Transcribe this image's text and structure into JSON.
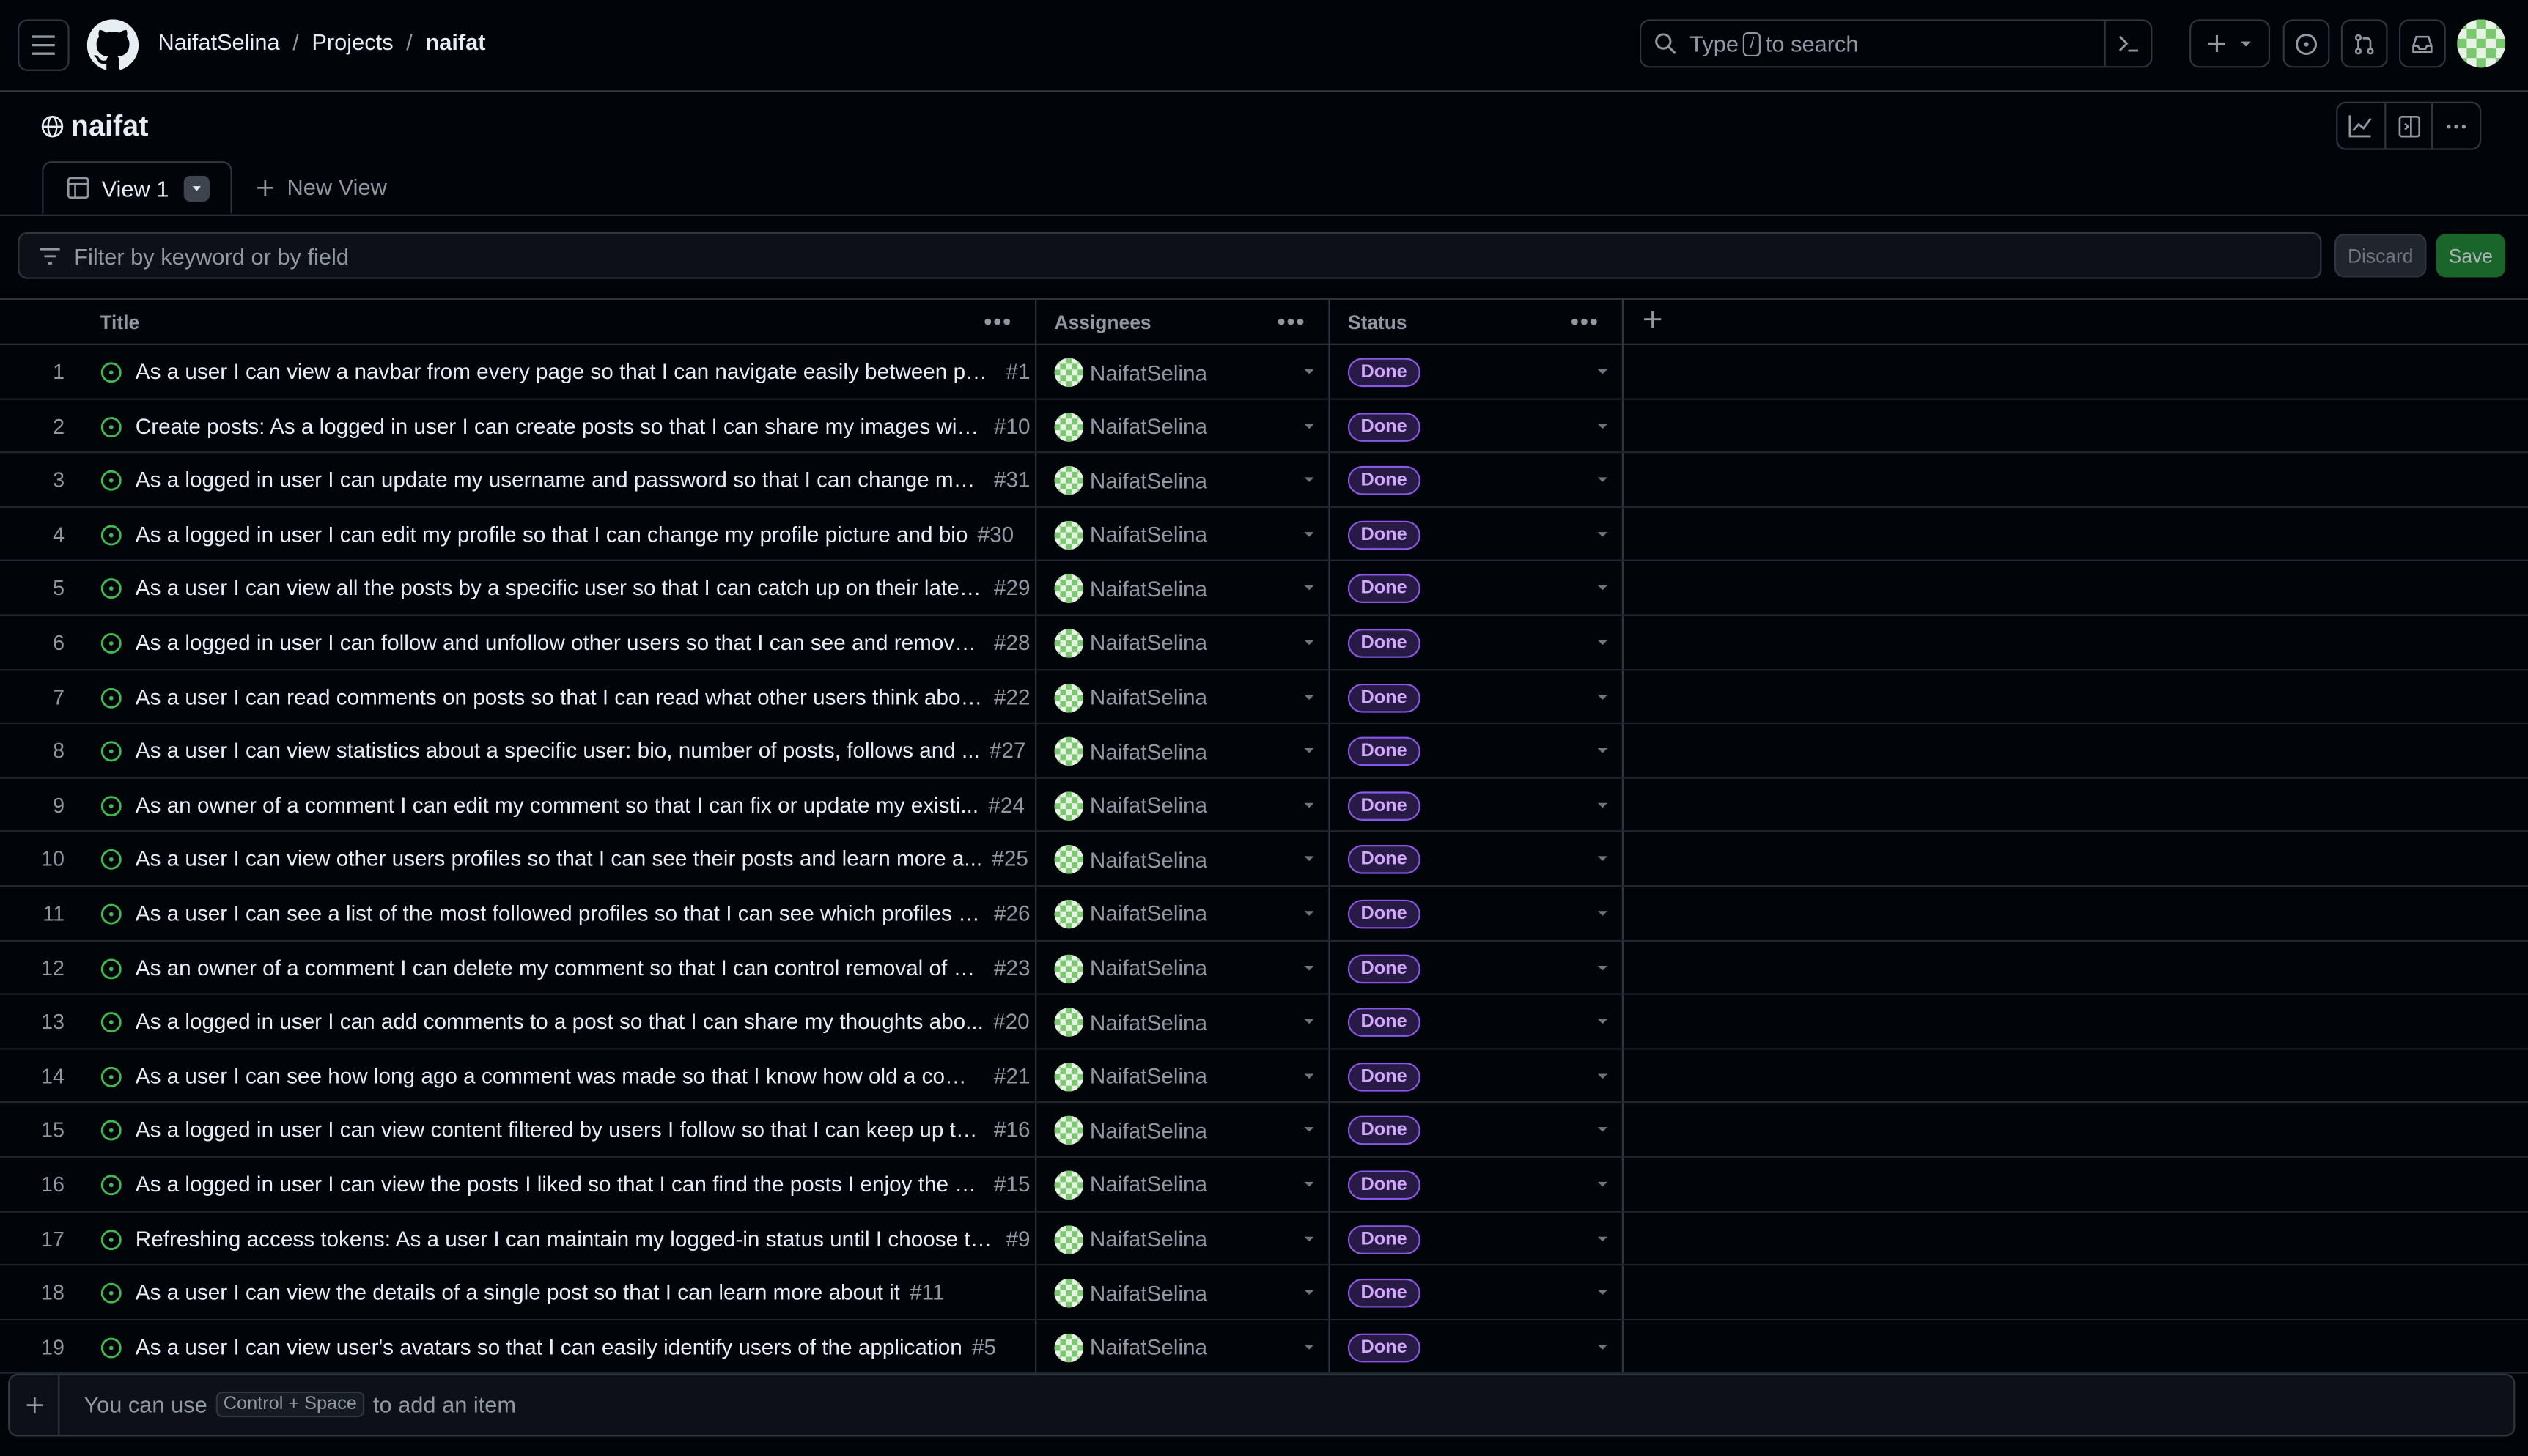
{
  "header": {
    "breadcrumb": [
      "NaifatSelina",
      "Projects",
      "naifat"
    ],
    "search_prefix": "Type",
    "search_key": "/",
    "search_suffix": "to search"
  },
  "project": {
    "title": "naifat",
    "tabs": [
      {
        "label": "View 1"
      }
    ],
    "new_view_label": "New View"
  },
  "filter": {
    "placeholder": "Filter by keyword or by field",
    "discard_label": "Discard",
    "save_label": "Save"
  },
  "table": {
    "columns": [
      "Title",
      "Assignees",
      "Status"
    ],
    "rows": [
      {
        "n": "1",
        "title": "As a user I can view a navbar from every page so that I can navigate easily between pag...",
        "issue": "#1",
        "assignee": "NaifatSelina",
        "status": "Done"
      },
      {
        "n": "2",
        "title": "Create posts: As a logged in user I can create posts so that I can share my images with...",
        "issue": "#10",
        "assignee": "NaifatSelina",
        "status": "Done"
      },
      {
        "n": "3",
        "title": "As a logged in user I can update my username and password so that I can change my ...",
        "issue": "#31",
        "assignee": "NaifatSelina",
        "status": "Done"
      },
      {
        "n": "4",
        "title": "As a logged in user I can edit my profile so that I can change my profile picture and bio",
        "issue": "#30",
        "assignee": "NaifatSelina",
        "status": "Done"
      },
      {
        "n": "5",
        "title": "As a user I can view all the posts by a specific user so that I can catch up on their lates...",
        "issue": "#29",
        "assignee": "NaifatSelina",
        "status": "Done"
      },
      {
        "n": "6",
        "title": "As a logged in user I can follow and unfollow other users so that I can see and remove ...",
        "issue": "#28",
        "assignee": "NaifatSelina",
        "status": "Done"
      },
      {
        "n": "7",
        "title": "As a user I can read comments on posts so that I can read what other users think abou...",
        "issue": "#22",
        "assignee": "NaifatSelina",
        "status": "Done"
      },
      {
        "n": "8",
        "title": "As a user I can view statistics about a specific user: bio, number of posts, follows and ...",
        "issue": "#27",
        "assignee": "NaifatSelina",
        "status": "Done"
      },
      {
        "n": "9",
        "title": "As an owner of a comment I can edit my comment so that I can fix or update my existi...",
        "issue": "#24",
        "assignee": "NaifatSelina",
        "status": "Done"
      },
      {
        "n": "10",
        "title": "As a user I can view other users profiles so that I can see their posts and learn more a...",
        "issue": "#25",
        "assignee": "NaifatSelina",
        "status": "Done"
      },
      {
        "n": "11",
        "title": "As a user I can see a list of the most followed profiles so that I can see which profiles a...",
        "issue": "#26",
        "assignee": "NaifatSelina",
        "status": "Done"
      },
      {
        "n": "12",
        "title": "As an owner of a comment I can delete my comment so that I can control removal of m...",
        "issue": "#23",
        "assignee": "NaifatSelina",
        "status": "Done"
      },
      {
        "n": "13",
        "title": "As a logged in user I can add comments to a post so that I can share my thoughts abo...",
        "issue": "#20",
        "assignee": "NaifatSelina",
        "status": "Done"
      },
      {
        "n": "14",
        "title": "As a user I can see how long ago a comment was made so that I know how old a comm...",
        "issue": "#21",
        "assignee": "NaifatSelina",
        "status": "Done"
      },
      {
        "n": "15",
        "title": "As a logged in user I can view content filtered by users I follow so that I can keep up to...",
        "issue": "#16",
        "assignee": "NaifatSelina",
        "status": "Done"
      },
      {
        "n": "16",
        "title": "As a logged in user I can view the posts I liked so that I can find the posts I enjoy the m...",
        "issue": "#15",
        "assignee": "NaifatSelina",
        "status": "Done"
      },
      {
        "n": "17",
        "title": "Refreshing access tokens: As a user I can maintain my logged-in status until I choose to...",
        "issue": "#9",
        "assignee": "NaifatSelina",
        "status": "Done"
      },
      {
        "n": "18",
        "title": "As a user I can view the details of a single post so that I can learn more about it",
        "issue": "#11",
        "assignee": "NaifatSelina",
        "status": "Done"
      },
      {
        "n": "19",
        "title": "As a user I can view user's avatars so that I can easily identify users of the application",
        "issue": "#5",
        "assignee": "NaifatSelina",
        "status": "Done"
      }
    ]
  },
  "add_item": {
    "prefix": "You can use",
    "shortcut": "Control + Space",
    "suffix": "to add an item"
  },
  "colors": {
    "background": "#010409",
    "border": "#30363d",
    "open_issue_green": "#3fb950",
    "status_done_purple": "#8957e5",
    "save_green": "#238636"
  },
  "icons": [
    "menu-icon",
    "github-logo-icon",
    "search-icon",
    "command-palette-icon",
    "plus-icon",
    "issues-icon",
    "pull-requests-icon",
    "inbox-icon",
    "globe-icon",
    "insights-chart-icon",
    "side-panel-icon",
    "kebab-icon",
    "table-view-icon",
    "filter-icon",
    "open-issue-icon"
  ]
}
